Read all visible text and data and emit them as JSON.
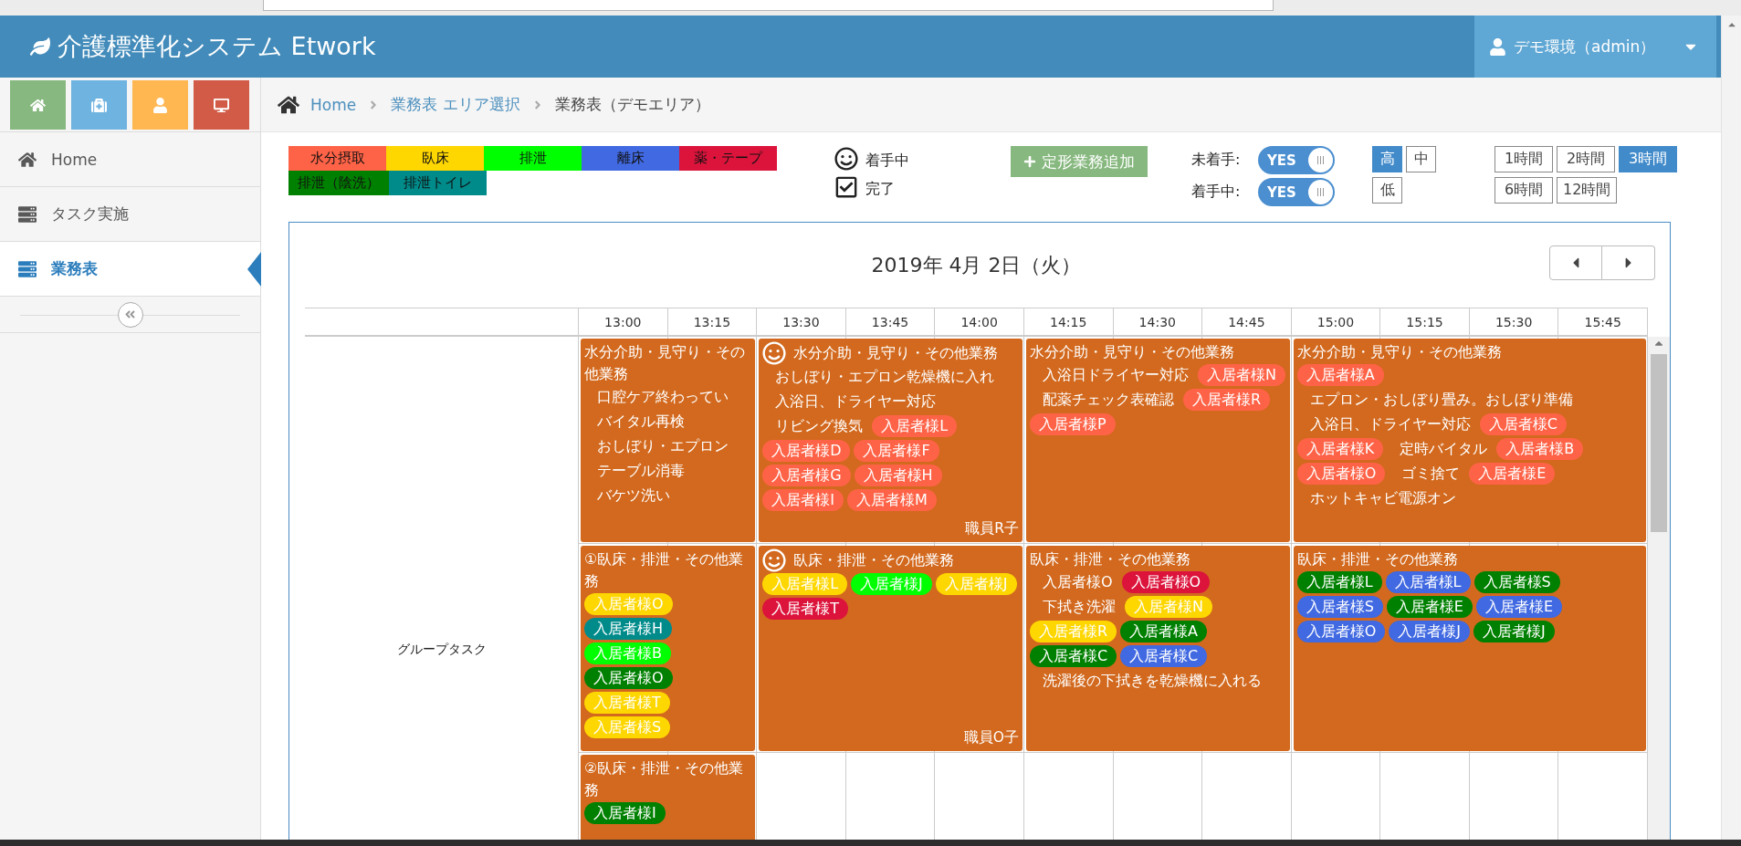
{
  "app": {
    "title": "介護標準化システム Etwork",
    "user": "デモ環境（admin）"
  },
  "menu": [
    {
      "label": "Home",
      "selected": false
    },
    {
      "label": "タスク実施",
      "selected": false
    },
    {
      "label": "業務表",
      "selected": true
    }
  ],
  "breadcrumb": [
    {
      "label": "Home",
      "kind": "link"
    },
    {
      "label": "業務表 エリア選択",
      "kind": "link"
    },
    {
      "label": "業務表（デモエリア）",
      "kind": "current"
    }
  ],
  "legend": [
    {
      "label": "水分摂取",
      "color": "#ff6347"
    },
    {
      "label": "臥床",
      "color": "#ffd700"
    },
    {
      "label": "排泄",
      "color": "#00ff00"
    },
    {
      "label": "離床",
      "color": "#4169e1"
    },
    {
      "label": "薬・テープ",
      "color": "#dc143c"
    },
    {
      "label": "排泄（陰洗）",
      "color": "#008000"
    },
    {
      "label": "排泄トイレ",
      "color": "#008b8b"
    }
  ],
  "status_legend": [
    {
      "kind": "in_progress",
      "label": "着手中"
    },
    {
      "kind": "done",
      "label": "完了"
    }
  ],
  "add_button": "定形業務追加",
  "filters": [
    {
      "label": "未着手:",
      "value": "YES",
      "on": true
    },
    {
      "label": "着手中:",
      "value": "YES",
      "on": true
    }
  ],
  "priority": [
    {
      "label": "高",
      "selected": true
    },
    {
      "label": "中",
      "selected": false
    },
    {
      "label": "低",
      "selected": false
    }
  ],
  "ranges": [
    {
      "label": "1時間",
      "selected": false
    },
    {
      "label": "2時間",
      "selected": false
    },
    {
      "label": "3時間",
      "selected": true
    },
    {
      "label": "6時間",
      "selected": false
    },
    {
      "label": "12時間",
      "selected": false
    }
  ],
  "schedule": {
    "date": "2019年 4月 2日（火）",
    "times": [
      "13:00",
      "13:15",
      "13:30",
      "13:45",
      "14:00",
      "14:15",
      "14:30",
      "14:45",
      "15:00",
      "15:15",
      "15:30",
      "15:45"
    ],
    "group_label": "グループタスク",
    "rows": [
      {
        "cards": [
          {
            "in_progress": false,
            "title": "水分介助・見守り・その他業務",
            "items": [
              {
                "kind": "text",
                "label": "口腔ケア終わってい"
              },
              {
                "kind": "text",
                "label": "バイタル再検"
              },
              {
                "kind": "text",
                "label": "おしぼり・エプロン"
              },
              {
                "kind": "text",
                "label": "テーブル消毒"
              },
              {
                "kind": "text",
                "label": "バケツ洗い"
              }
            ]
          },
          {
            "in_progress": true,
            "title": "水分介助・見守り・その他業務",
            "staff": "職員R子",
            "items": [
              {
                "kind": "text",
                "label": "おしぼり・エプロン乾燥機に入れ"
              },
              {
                "kind": "text",
                "label": "入浴日、ドライヤー対応"
              },
              {
                "kind": "text",
                "label": "リビング換気"
              },
              {
                "kind": "chip",
                "label": "入居者様L",
                "color": "#ff6347"
              },
              {
                "kind": "chip",
                "label": "入居者様D",
                "color": "#ff6347"
              },
              {
                "kind": "chip",
                "label": "入居者様F",
                "color": "#ff6347"
              },
              {
                "kind": "chip",
                "label": "入居者様G",
                "color": "#ff6347"
              },
              {
                "kind": "chip",
                "label": "入居者様H",
                "color": "#ff6347"
              },
              {
                "kind": "chip",
                "label": "入居者様I",
                "color": "#ff6347"
              },
              {
                "kind": "chip",
                "label": "入居者様M",
                "color": "#ff6347"
              }
            ]
          },
          {
            "in_progress": false,
            "title": "水分介助・見守り・その他業務",
            "items": [
              {
                "kind": "text",
                "label": "入浴日ドライヤー対応"
              },
              {
                "kind": "chip",
                "label": "入居者様N",
                "color": "#ff6347"
              },
              {
                "kind": "text",
                "label": "配薬チェック表確認"
              },
              {
                "kind": "chip",
                "label": "入居者様R",
                "color": "#ff6347"
              },
              {
                "kind": "chip",
                "label": "入居者様P",
                "color": "#ff6347"
              }
            ]
          },
          {
            "in_progress": false,
            "title": "水分介助・見守り・その他業務",
            "items": [
              {
                "kind": "chip",
                "label": "入居者様A",
                "color": "#ff6347"
              },
              {
                "kind": "text",
                "label": "エプロン・おしぼり畳み。おしぼり準備"
              },
              {
                "kind": "text",
                "label": "入浴日、ドライヤー対応"
              },
              {
                "kind": "chip",
                "label": "入居者様C",
                "color": "#ff6347"
              },
              {
                "kind": "chip",
                "label": "入居者様K",
                "color": "#ff6347"
              },
              {
                "kind": "text",
                "label": "定時バイタル"
              },
              {
                "kind": "chip",
                "label": "入居者様B",
                "color": "#ff6347"
              },
              {
                "kind": "chip",
                "label": "入居者様O",
                "color": "#ff6347"
              },
              {
                "kind": "text",
                "label": "ゴミ捨て"
              },
              {
                "kind": "chip",
                "label": "入居者様E",
                "color": "#ff6347"
              },
              {
                "kind": "text",
                "label": "ホットキャビ電源オン"
              }
            ]
          }
        ]
      },
      {
        "cards": [
          {
            "in_progress": false,
            "title": "①臥床・排泄・その他業務",
            "items": [
              {
                "kind": "chip",
                "label": "入居者様O",
                "color": "#ffd700"
              },
              {
                "kind": "chip",
                "label": "入居者様H",
                "color": "#008b8b"
              },
              {
                "kind": "chip",
                "label": "入居者様B",
                "color": "#00ff00"
              },
              {
                "kind": "chip",
                "label": "入居者様O",
                "color": "#008000"
              },
              {
                "kind": "chip",
                "label": "入居者様T",
                "color": "#ffd700"
              },
              {
                "kind": "chip",
                "label": "入居者様S",
                "color": "#ffd700"
              }
            ]
          },
          {
            "in_progress": true,
            "title": "臥床・排泄・その他業務",
            "staff": "職員O子",
            "items": [
              {
                "kind": "chip",
                "label": "入居者様L",
                "color": "#ffd700"
              },
              {
                "kind": "chip",
                "label": "入居者様J",
                "color": "#00ff00"
              },
              {
                "kind": "chip",
                "label": "入居者様J",
                "color": "#ffd700"
              },
              {
                "kind": "chip",
                "label": "入居者様T",
                "color": "#dc143c"
              }
            ]
          },
          {
            "in_progress": false,
            "title": "臥床・排泄・その他業務",
            "items": [
              {
                "kind": "text",
                "label": "入居者様O"
              },
              {
                "kind": "chip",
                "label": "入居者様O",
                "color": "#dc143c"
              },
              {
                "kind": "text",
                "label": "下拭き洗濯"
              },
              {
                "kind": "chip",
                "label": "入居者様N",
                "color": "#ffd700"
              },
              {
                "kind": "chip",
                "label": "入居者様R",
                "color": "#ffd700"
              },
              {
                "kind": "chip",
                "label": "入居者様A",
                "color": "#008000"
              },
              {
                "kind": "chip",
                "label": "入居者様C",
                "color": "#008000"
              },
              {
                "kind": "chip",
                "label": "入居者様C",
                "color": "#4169e1"
              },
              {
                "kind": "text",
                "label": "洗濯後の下拭きを乾燥機に入れる"
              }
            ]
          },
          {
            "in_progress": false,
            "title": "臥床・排泄・その他業務",
            "items": [
              {
                "kind": "chip",
                "label": "入居者様L",
                "color": "#008000"
              },
              {
                "kind": "chip",
                "label": "入居者様L",
                "color": "#4169e1"
              },
              {
                "kind": "chip",
                "label": "入居者様S",
                "color": "#008000"
              },
              {
                "kind": "chip",
                "label": "入居者様S",
                "color": "#4169e1"
              },
              {
                "kind": "chip",
                "label": "入居者様E",
                "color": "#008000"
              },
              {
                "kind": "chip",
                "label": "入居者様E",
                "color": "#4169e1"
              },
              {
                "kind": "chip",
                "label": "入居者様O",
                "color": "#4169e1"
              },
              {
                "kind": "chip",
                "label": "入居者様J",
                "color": "#4169e1"
              },
              {
                "kind": "chip",
                "label": "入居者様J",
                "color": "#008000"
              }
            ]
          }
        ]
      },
      {
        "cards": [
          {
            "in_progress": false,
            "title": "②臥床・排泄・その他業務",
            "items": [
              {
                "kind": "chip",
                "label": "入居者様I",
                "color": "#008000"
              }
            ]
          }
        ]
      }
    ]
  }
}
